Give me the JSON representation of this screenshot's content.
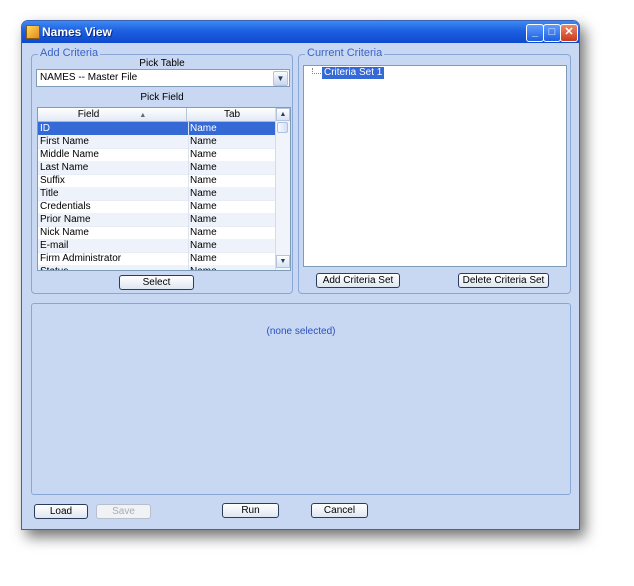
{
  "window": {
    "title": "Names View",
    "controls": {
      "minimize": "_",
      "maximize": "□",
      "close": "✕"
    }
  },
  "add_criteria": {
    "group_label": "Add Criteria",
    "pick_table_label": "Pick Table",
    "table_value": "NAMES -- Master File",
    "pick_field_label": "Pick Field",
    "columns": [
      "Field",
      "Tab"
    ],
    "rows": [
      {
        "field": "ID",
        "tab": "Name"
      },
      {
        "field": "First Name",
        "tab": "Name"
      },
      {
        "field": "Middle Name",
        "tab": "Name"
      },
      {
        "field": "Last Name",
        "tab": "Name"
      },
      {
        "field": "Suffix",
        "tab": "Name"
      },
      {
        "field": "Title",
        "tab": "Name"
      },
      {
        "field": "Credentials",
        "tab": "Name"
      },
      {
        "field": "Prior Name",
        "tab": "Name"
      },
      {
        "field": "Nick Name",
        "tab": "Name"
      },
      {
        "field": "E-mail",
        "tab": "Name"
      },
      {
        "field": "Firm Administrator",
        "tab": "Name"
      },
      {
        "field": "Status",
        "tab": "Name"
      }
    ],
    "select_button": "Select"
  },
  "current_criteria": {
    "group_label": "Current Criteria",
    "tree_node": "Criteria Set 1",
    "add_button": "Add Criteria Set",
    "delete_button": "Delete Criteria Set"
  },
  "detail": {
    "empty_text": "(none selected)"
  },
  "footer": {
    "load": "Load",
    "save": "Save",
    "run": "Run",
    "cancel": "Cancel"
  }
}
